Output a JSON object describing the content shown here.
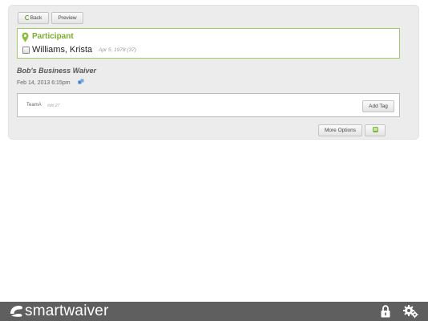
{
  "toolbar": {
    "back_label": "Back",
    "preview_label": "Preview"
  },
  "participant": {
    "section_label": "Participant",
    "name": "Williams, Krista",
    "dob": "Apr 5, 1978 (37)"
  },
  "waiver": {
    "title": "Bob's Business Waiver",
    "signed_date": "Feb 14, 2013 6:15pm"
  },
  "tags": {
    "tag_name": "TeamA",
    "tag_note": "#dd 27",
    "add_tag_label": "Add Tag"
  },
  "actions": {
    "more_options_label": "More Options"
  },
  "footer": {
    "brand": "smartwaiver"
  },
  "colors": {
    "accent_green": "#7aae2c",
    "footer_bg": "#5f5f5f",
    "panel_bg": "#ececec"
  },
  "icons": [
    "back-icon",
    "pin-icon",
    "sync-icon",
    "pdf-icon",
    "lock-icon",
    "gear-icon",
    "logo-icon"
  ]
}
